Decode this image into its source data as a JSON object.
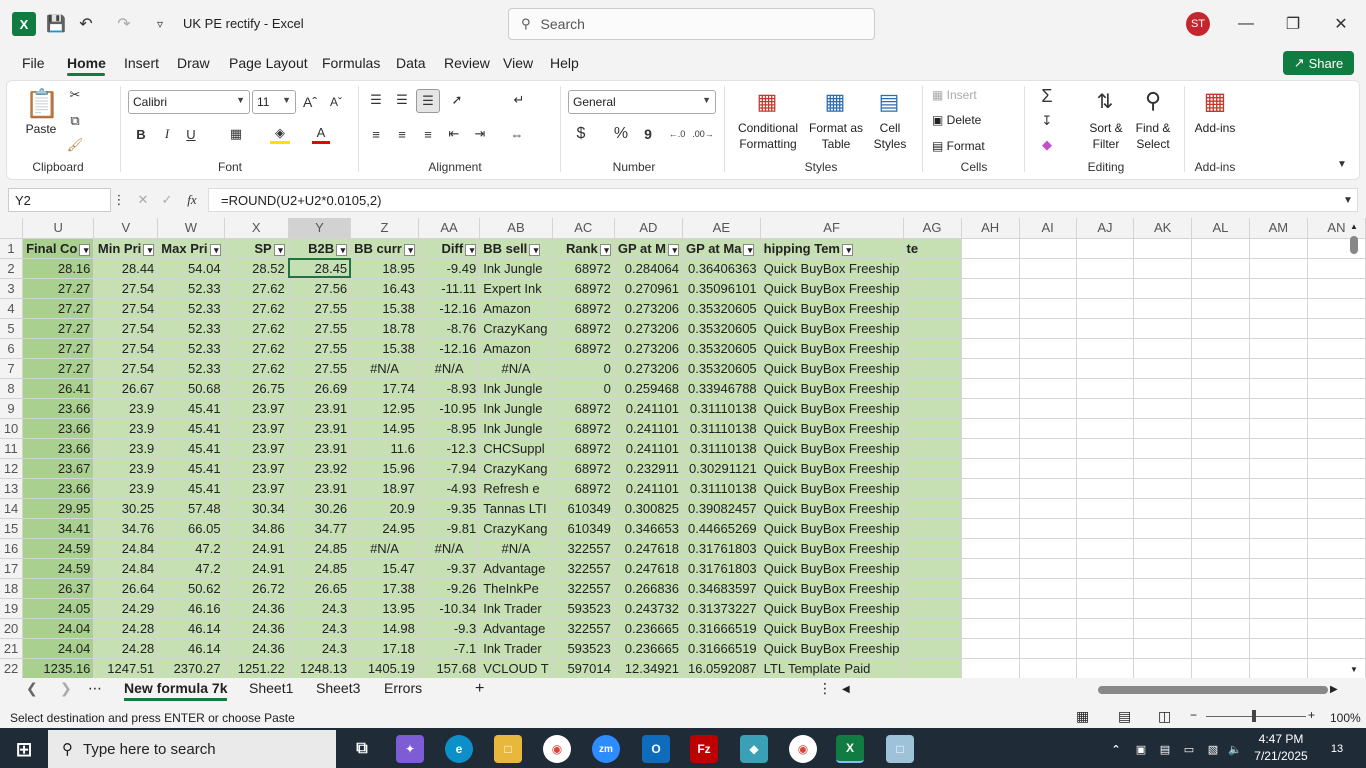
{
  "app": {
    "title": "UK PE rectify  -  Excel",
    "search_placeholder": "Search",
    "avatar": "ST",
    "share": "Share"
  },
  "menu": [
    "File",
    "Home",
    "Insert",
    "Draw",
    "Page Layout",
    "Formulas",
    "Data",
    "Review",
    "View",
    "Help"
  ],
  "ribbon": {
    "paste": "Paste",
    "clipboard": "Clipboard",
    "font_name": "Calibri",
    "font_size": "11",
    "font": "Font",
    "alignment": "Alignment",
    "number_format": "General",
    "number": "Number",
    "cond_fmt": [
      "Conditional",
      "Formatting"
    ],
    "format_table": [
      "Format as",
      "Table"
    ],
    "cell_styles": [
      "Cell",
      "Styles"
    ],
    "styles": "Styles",
    "insert": "Insert",
    "delete": "Delete",
    "format": "Format",
    "cells": "Cells",
    "sort": [
      "Sort &",
      "Filter"
    ],
    "find": [
      "Find &",
      "Select"
    ],
    "editing": "Editing",
    "addins_btn": "Add-ins",
    "addins": "Add-ins",
    "currency": "$",
    "percent": "%",
    "comma": "9"
  },
  "namebox": "Y2",
  "formula": "=ROUND(U2+U2*0.0105,2)",
  "columns": [
    "U",
    "V",
    "W",
    "X",
    "Y",
    "Z",
    "AA",
    "AB",
    "AC",
    "AD",
    "AE",
    "AF",
    "AG",
    "AH",
    "AI",
    "AJ",
    "AK",
    "AL",
    "AM",
    "AN"
  ],
  "header_row": [
    "Final Co",
    "Min Pri",
    "Max Pri",
    "SP",
    "B2B",
    "BB curr",
    "Diff",
    "BB sell",
    "Rank",
    "GP at M",
    "GP at Ma",
    "hipping Tem",
    "te"
  ],
  "rows": [
    {
      "n": "2",
      "c": [
        "28.16",
        "28.44",
        "54.04",
        "28.52",
        "28.45",
        "18.95",
        "-9.49",
        "Ink Jungle",
        "68972",
        "0.284064",
        "0.36406363",
        "Quick BuyBox Freeship"
      ]
    },
    {
      "n": "3",
      "c": [
        "27.27",
        "27.54",
        "52.33",
        "27.62",
        "27.56",
        "16.43",
        "-11.11",
        "Expert Ink",
        "68972",
        "0.270961",
        "0.35096101",
        "Quick BuyBox Freeship"
      ]
    },
    {
      "n": "4",
      "c": [
        "27.27",
        "27.54",
        "52.33",
        "27.62",
        "27.55",
        "15.38",
        "-12.16",
        "Amazon",
        "68972",
        "0.273206",
        "0.35320605",
        "Quick BuyBox Freeship"
      ]
    },
    {
      "n": "5",
      "c": [
        "27.27",
        "27.54",
        "52.33",
        "27.62",
        "27.55",
        "18.78",
        "-8.76",
        "CrazyKang",
        "68972",
        "0.273206",
        "0.35320605",
        "Quick BuyBox Freeship"
      ]
    },
    {
      "n": "6",
      "c": [
        "27.27",
        "27.54",
        "52.33",
        "27.62",
        "27.55",
        "15.38",
        "-12.16",
        "Amazon",
        "68972",
        "0.273206",
        "0.35320605",
        "Quick BuyBox Freeship"
      ]
    },
    {
      "n": "7",
      "c": [
        "27.27",
        "27.54",
        "52.33",
        "27.62",
        "27.55",
        "#N/A",
        "#N/A",
        "#N/A",
        "0",
        "0.273206",
        "0.35320605",
        "Quick BuyBox Freeship"
      ]
    },
    {
      "n": "8",
      "c": [
        "26.41",
        "26.67",
        "50.68",
        "26.75",
        "26.69",
        "17.74",
        "-8.93",
        "Ink Jungle",
        "0",
        "0.259468",
        "0.33946788",
        "Quick BuyBox Freeship"
      ]
    },
    {
      "n": "9",
      "c": [
        "23.66",
        "23.9",
        "45.41",
        "23.97",
        "23.91",
        "12.95",
        "-10.95",
        "Ink Jungle",
        "68972",
        "0.241101",
        "0.31110138",
        "Quick BuyBox Freeship"
      ]
    },
    {
      "n": "10",
      "c": [
        "23.66",
        "23.9",
        "45.41",
        "23.97",
        "23.91",
        "14.95",
        "-8.95",
        "Ink Jungle",
        "68972",
        "0.241101",
        "0.31110138",
        "Quick BuyBox Freeship"
      ]
    },
    {
      "n": "11",
      "c": [
        "23.66",
        "23.9",
        "45.41",
        "23.97",
        "23.91",
        "11.6",
        "-12.3",
        "CHCSuppl",
        "68972",
        "0.241101",
        "0.31110138",
        "Quick BuyBox Freeship"
      ]
    },
    {
      "n": "12",
      "c": [
        "23.67",
        "23.9",
        "45.41",
        "23.97",
        "23.92",
        "15.96",
        "-7.94",
        "CrazyKang",
        "68972",
        "0.232911",
        "0.30291121",
        "Quick BuyBox Freeship"
      ]
    },
    {
      "n": "13",
      "c": [
        "23.66",
        "23.9",
        "45.41",
        "23.97",
        "23.91",
        "18.97",
        "-4.93",
        "Refresh e",
        "68972",
        "0.241101",
        "0.31110138",
        "Quick BuyBox Freeship"
      ]
    },
    {
      "n": "14",
      "c": [
        "29.95",
        "30.25",
        "57.48",
        "30.34",
        "30.26",
        "20.9",
        "-9.35",
        "Tannas LTI",
        "610349",
        "0.300825",
        "0.39082457",
        "Quick BuyBox Freeship"
      ]
    },
    {
      "n": "15",
      "c": [
        "34.41",
        "34.76",
        "66.05",
        "34.86",
        "34.77",
        "24.95",
        "-9.81",
        "CrazyKang",
        "610349",
        "0.346653",
        "0.44665269",
        "Quick BuyBox Freeship"
      ]
    },
    {
      "n": "16",
      "c": [
        "24.59",
        "24.84",
        "47.2",
        "24.91",
        "24.85",
        "#N/A",
        "#N/A",
        "#N/A",
        "322557",
        "0.247618",
        "0.31761803",
        "Quick BuyBox Freeship"
      ]
    },
    {
      "n": "17",
      "c": [
        "24.59",
        "24.84",
        "47.2",
        "24.91",
        "24.85",
        "15.47",
        "-9.37",
        "Advantage",
        "322557",
        "0.247618",
        "0.31761803",
        "Quick BuyBox Freeship"
      ]
    },
    {
      "n": "18",
      "c": [
        "26.37",
        "26.64",
        "50.62",
        "26.72",
        "26.65",
        "17.38",
        "-9.26",
        "TheInkPe",
        "322557",
        "0.266836",
        "0.34683597",
        "Quick BuyBox Freeship"
      ]
    },
    {
      "n": "19",
      "c": [
        "24.05",
        "24.29",
        "46.16",
        "24.36",
        "24.3",
        "13.95",
        "-10.34",
        "Ink Trader",
        "593523",
        "0.243732",
        "0.31373227",
        "Quick BuyBox Freeship"
      ]
    },
    {
      "n": "20",
      "c": [
        "24.04",
        "24.28",
        "46.14",
        "24.36",
        "24.3",
        "14.98",
        "-9.3",
        "Advantage",
        "322557",
        "0.236665",
        "0.31666519",
        "Quick BuyBox Freeship"
      ]
    },
    {
      "n": "21",
      "c": [
        "24.04",
        "24.28",
        "46.14",
        "24.36",
        "24.3",
        "17.18",
        "-7.1",
        "Ink Trader",
        "593523",
        "0.236665",
        "0.31666519",
        "Quick BuyBox Freeship"
      ]
    },
    {
      "n": "22",
      "c": [
        "1235.16",
        "1247.51",
        "2370.27",
        "1251.22",
        "1248.13",
        "1405.19",
        "157.68",
        "VCLOUD T",
        "597014",
        "12.34921",
        "16.0592087",
        "LTL Template Paid"
      ]
    }
  ],
  "sheets": [
    "New formula 7k",
    "Sheet1",
    "Sheet3",
    "Errors"
  ],
  "status": "Select destination and press ENTER or choose Paste",
  "zoom": "100%",
  "taskbar": {
    "search": "Type here to search",
    "time": "4:47 PM",
    "date": "7/21/2025",
    "notif": "13"
  }
}
